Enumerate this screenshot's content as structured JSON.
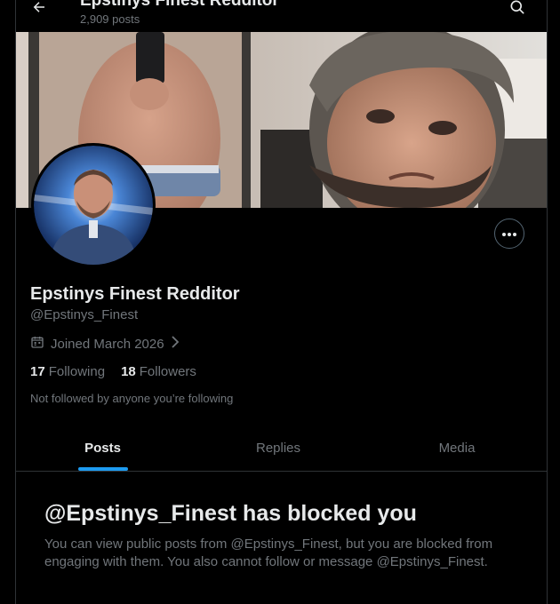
{
  "header": {
    "title": "Epstinys Finest Redditor",
    "post_count": "2,909 posts"
  },
  "profile": {
    "display_name": "Epstinys Finest Redditor",
    "handle": "@Epstinys_Finest",
    "joined": "Joined March 2026",
    "following_count": "17",
    "following_label": "Following",
    "followers_count": "18",
    "followers_label": "Followers",
    "not_followed_text": "Not followed by anyone you’re following"
  },
  "tabs": [
    {
      "label": "Posts",
      "active": true
    },
    {
      "label": "Replies",
      "active": false
    },
    {
      "label": "Media",
      "active": false
    }
  ],
  "blocked": {
    "title": "@Epstinys_Finest has blocked you",
    "message": "You can view public posts from @Epstinys_Finest, but you are blocked from engaging with them. You also cannot follow or message @Epstinys_Finest."
  },
  "colors": {
    "background": "#000000",
    "text_primary": "#e7e9ea",
    "text_secondary": "#71767b",
    "accent": "#1d9bf0",
    "border": "#2f3336"
  },
  "icons": [
    "back-arrow-icon",
    "search-icon",
    "more-icon",
    "calendar-icon",
    "chevron-right-icon"
  ]
}
